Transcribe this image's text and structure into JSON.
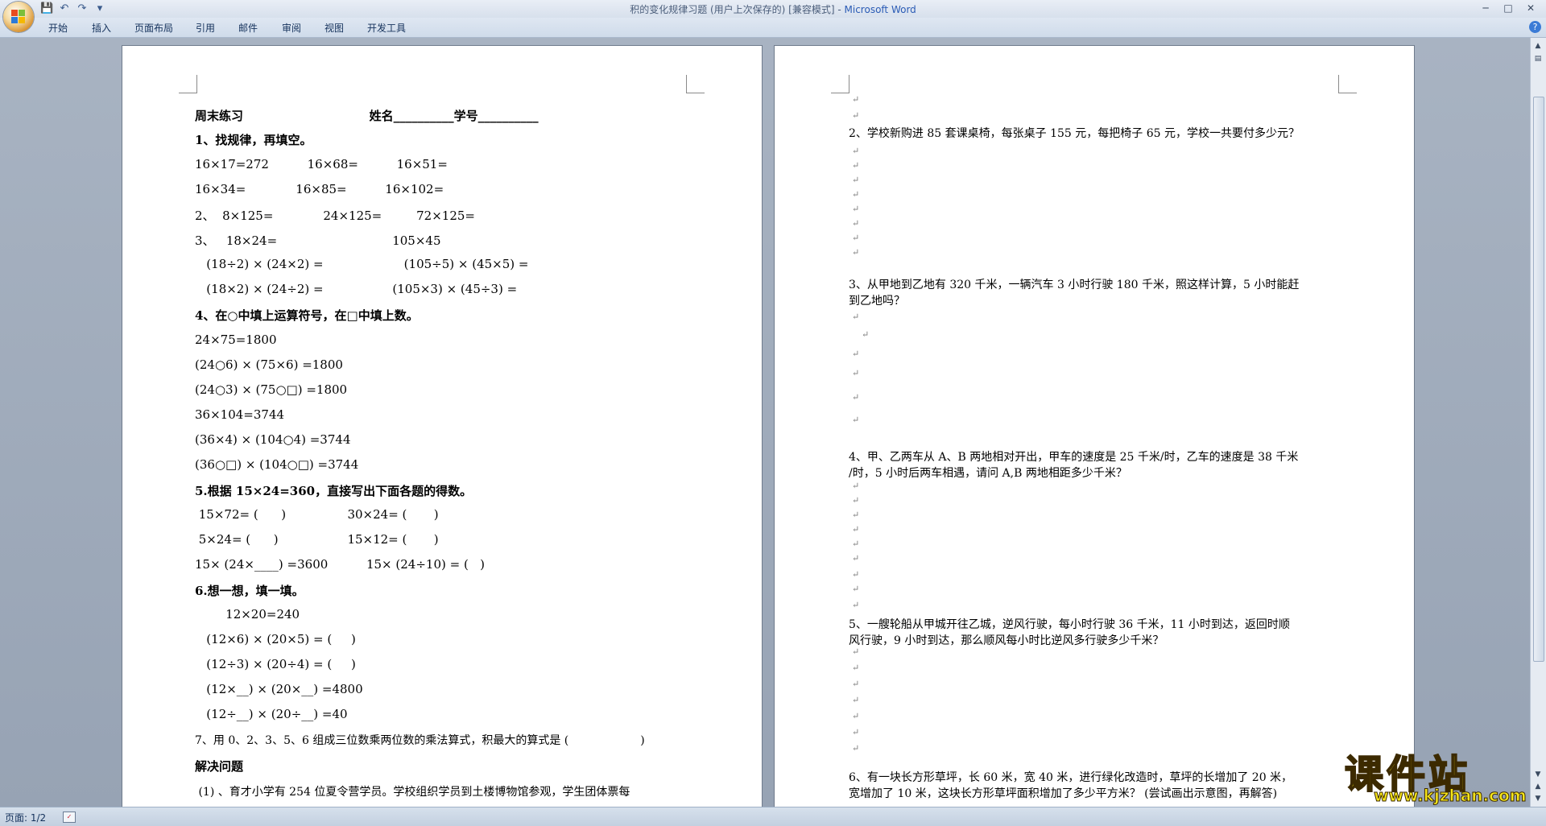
{
  "window": {
    "title": "积的变化规律习题 (用户上次保存的) [兼容模式] - ",
    "app_name": "Microsoft Word",
    "minimize": "─",
    "maximize": "□",
    "close": "✕"
  },
  "qat": {
    "save": "💾",
    "undo": "↶",
    "redo": "↷",
    "customize": "▾"
  },
  "ribbon_tabs": [
    "开始",
    "插入",
    "页面布局",
    "引用",
    "邮件",
    "审阅",
    "视图",
    "开发工具"
  ],
  "help": "?",
  "status": {
    "page": "页面: 1/2",
    "icon_name": "proofing-icon"
  },
  "watermark": {
    "text": "课件站",
    "url": "www.kjzhan.com"
  },
  "page1": [
    "周末练习                              姓名__________学号__________",
    "1、找规律，再填空。",
    "16×17=272          16×68=          16×51=",
    "16×34=             16×85=          16×102=",
    "2、  8×125=             24×125=         72×125=",
    "3、   18×24=                              105×45",
    "   (18÷2) × (24×2) =                     (105÷5) × (45×5) =",
    "   (18×2) × (24÷2) =                  (105×3) × (45÷3) =",
    "4、在○中填上运算符号，在□中填上数。",
    "24×75=1800",
    "(24○6) × (75×6) =1800",
    "(24○3) × (75○□) =1800",
    "36×104=3744",
    "(36×4) × (104○4) =3744",
    "(36○□) × (104○□) =3744",
    "5.根据 15×24=360，直接写出下面各题的得数。",
    " 15×72= (      )                30×24= (       )",
    " 5×24= (      )                  15×12= (       )",
    "15× (24×____) =3600          15× (24÷10) = (   )",
    "6.想一想，填一填。",
    "        12×20=240",
    "   (12×6) × (20×5) = (     )",
    "   (12÷3) × (20÷4) = (     )",
    "   (12×__) × (20×__) =4800",
    "   (12÷__) × (20÷__) =40",
    "7、用 0、2、3、5、6 组成三位数乘两位数的乘法算式，积最大的算式是 (                    )",
    "解决问题",
    " (1) 、育才小学有 254 位夏令营学员。学校组织学员到土楼博物馆参观，学生团体票每"
  ],
  "page2": [
    "2、学校新购进 85 套课桌椅，每张桌子 155 元，每把椅子 65 元，学校一共要付多少元？",
    "3、从甲地到乙地有 320 千米，一辆汽车 3 小时行驶 180 千米，照这样计算，5 小时能赶",
    "到乙地吗？",
    "4、甲、乙两车从 A、B 两地相对开出，甲车的速度是 25 千米/时，乙车的速度是 38 千米",
    "/时，5 小时后两车相遇，请问 A,B 两地相距多少千米？",
    "5、一艘轮船从甲城开往乙城，逆风行驶，每小时行驶 36 千米，11 小时到达，返回时顺",
    "风行驶，9 小时到达，那么顺风每小时比逆风多行驶多少千米？",
    "6、有一块长方形草坪，长 60 米，宽 40 米，进行绿化改造时，草坪的长增加了 20 米，",
    "宽增加了 10 米，这块长方形草坪面积增加了多少平方米？ (尝试画出示意图，再解答)"
  ],
  "para_mark": "↵"
}
